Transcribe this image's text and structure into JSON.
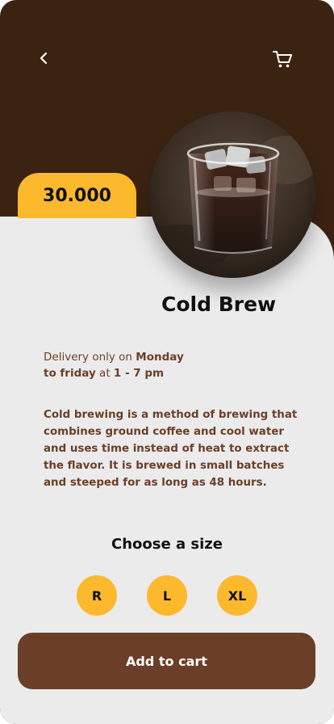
{
  "header": {
    "back_icon": "chevron-left-icon",
    "cart_icon": "shopping-cart-icon"
  },
  "product": {
    "price": "30.000",
    "name": "Cold Brew",
    "image": "iced-coffee-glass-photo"
  },
  "delivery": {
    "prefix": "Delivery only on ",
    "day_start": "Monday",
    "day_end": "to friday",
    "at": " at ",
    "hours": "1 - 7 pm"
  },
  "description": "Cold brewing is a method of brewing that combines ground coffee and cool water and uses time instead of heat to extract the flavor. It is brewed in small batches and steeped for as long as 48 hours.",
  "sizes": {
    "heading": "Choose a size",
    "options": [
      "R",
      "L",
      "XL"
    ]
  },
  "actions": {
    "add_to_cart": "Add to cart"
  },
  "colors": {
    "header_bg": "#3b2312",
    "sheet_bg": "#ebebeb",
    "accent_yellow": "#fdb92d",
    "brown": "#6b3f27"
  }
}
